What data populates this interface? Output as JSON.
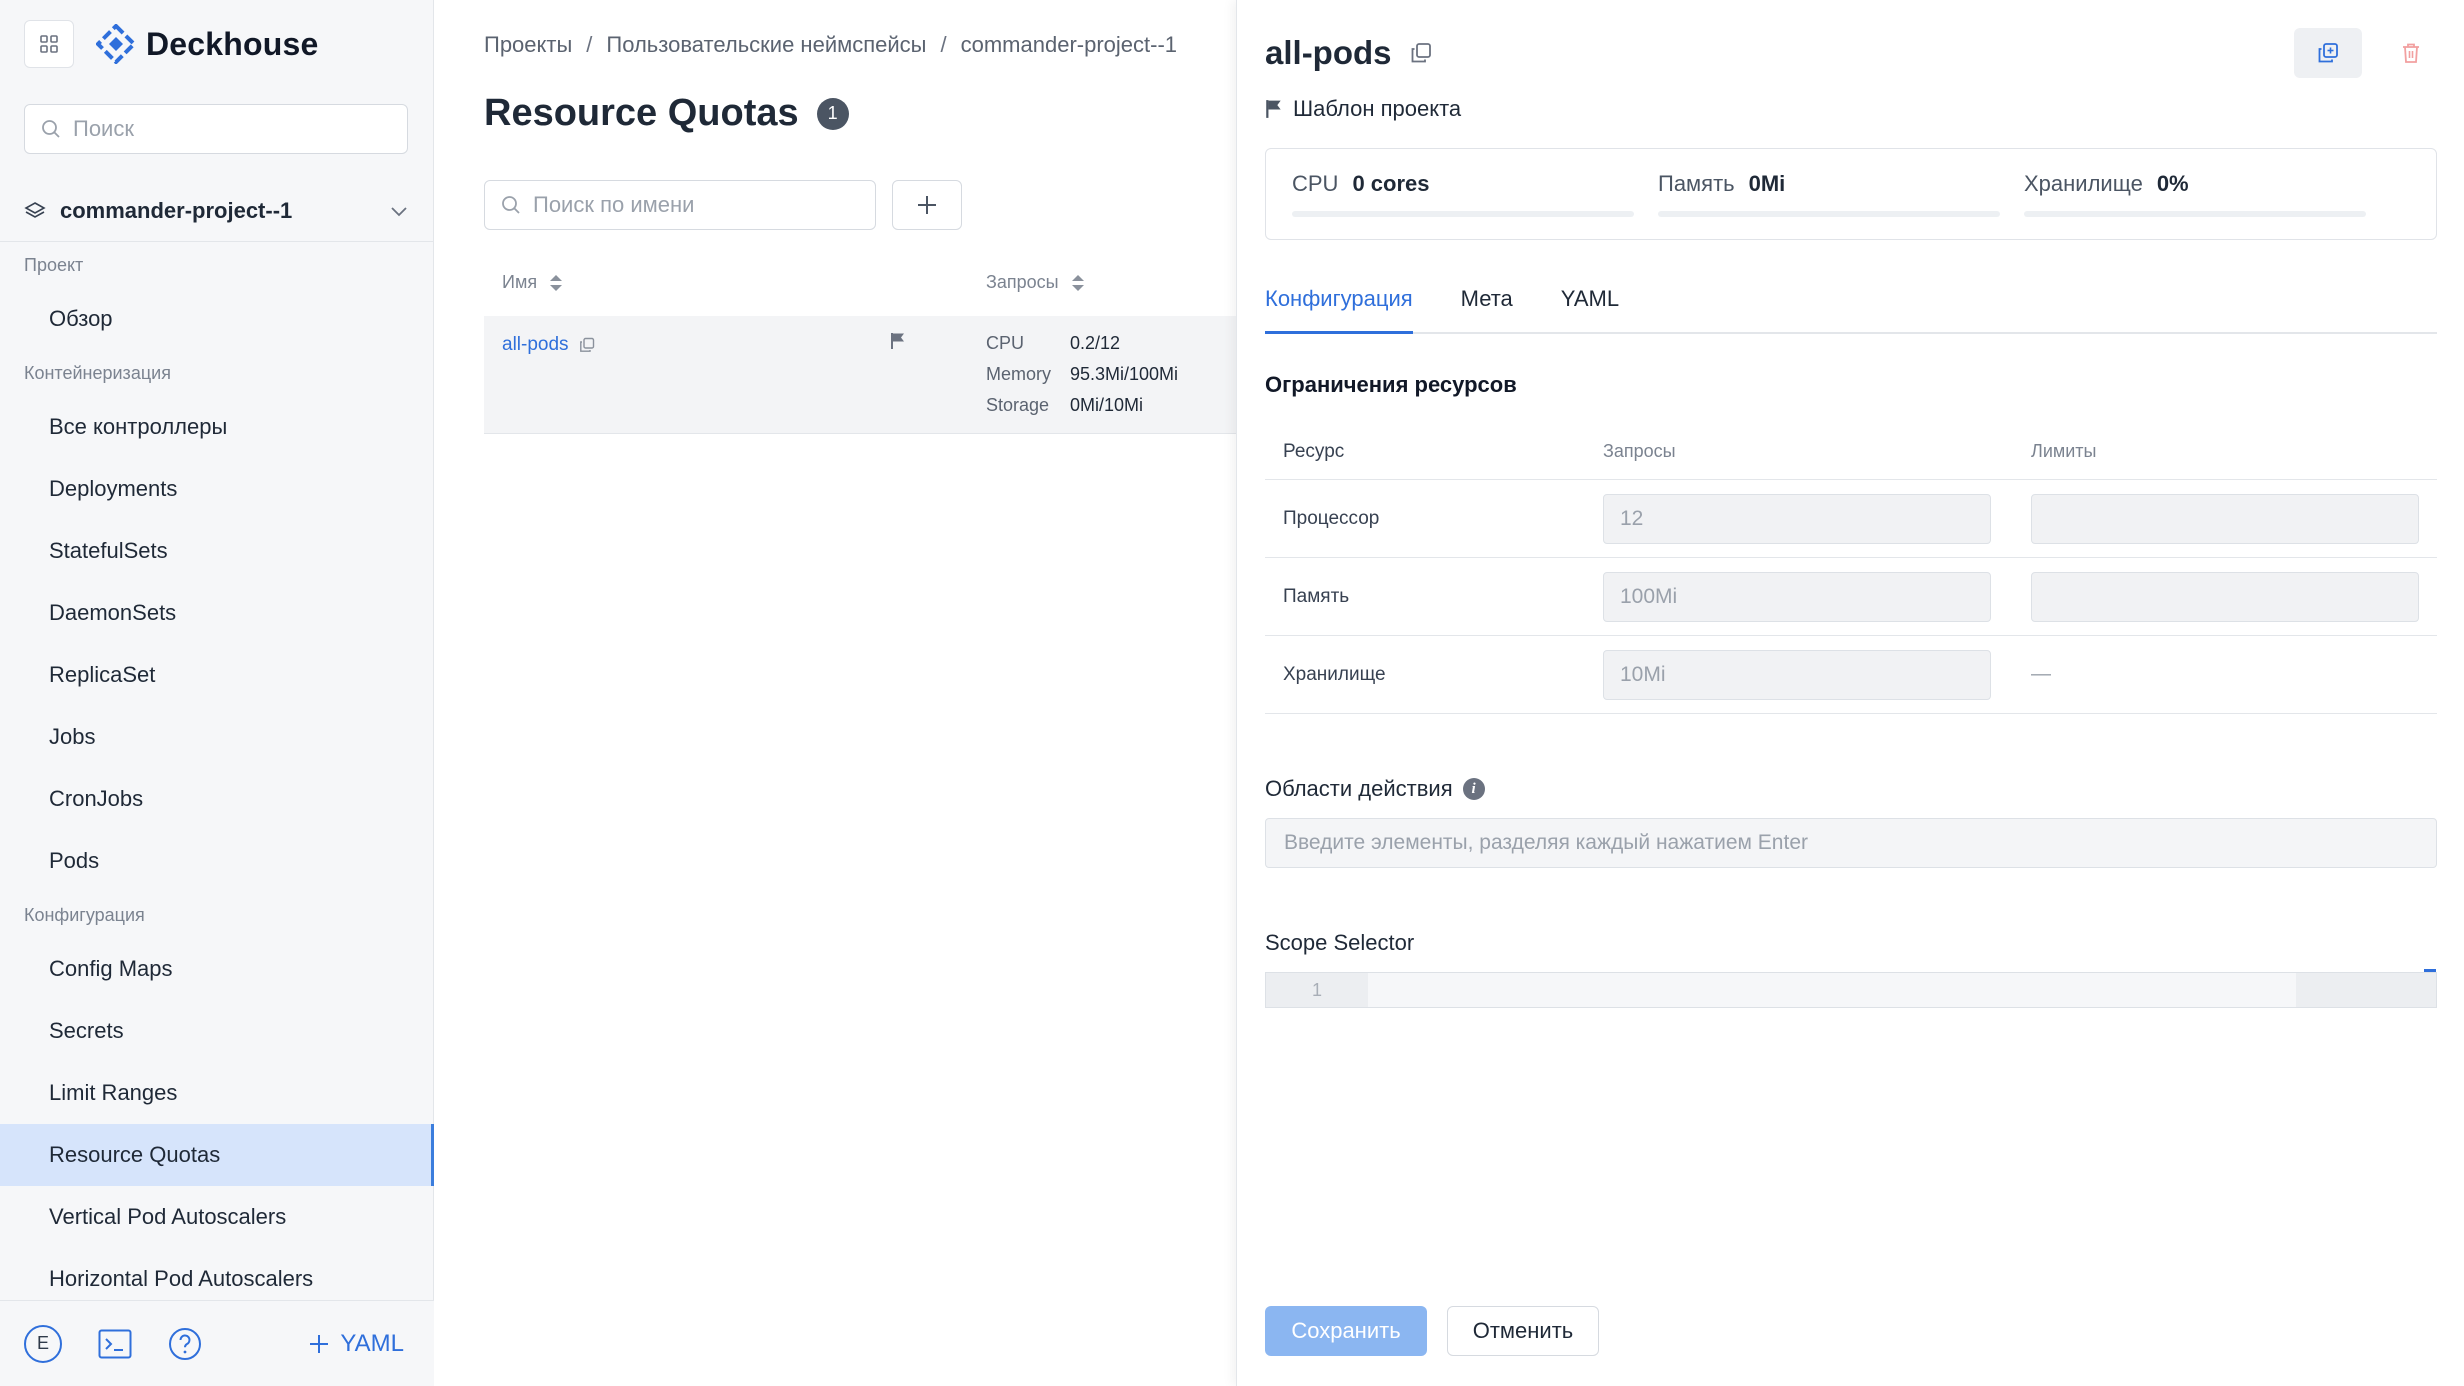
{
  "app": {
    "name": "Deckhouse",
    "brand_color": "#2f6fdb"
  },
  "sidebar": {
    "search_placeholder": "Поиск",
    "project": "commander-project--1",
    "groups": [
      {
        "label": "Проект",
        "items": [
          "Обзор"
        ]
      },
      {
        "label": "Контейнеризация",
        "items": [
          "Все контроллеры",
          "Deployments",
          "StatefulSets",
          "DaemonSets",
          "ReplicaSet",
          "Jobs",
          "CronJobs",
          "Pods"
        ]
      },
      {
        "label": "Конфигурация",
        "items": [
          "Config Maps",
          "Secrets",
          "Limit Ranges",
          "Resource Quotas",
          "Vertical Pod Autoscalers",
          "Horizontal Pod Autoscalers"
        ]
      }
    ],
    "active_item": "Resource Quotas",
    "user_initial": "E",
    "yaml_label": "YAML"
  },
  "main": {
    "breadcrumb": [
      "Проекты",
      "Пользовательские неймспейсы",
      "commander-project--1"
    ],
    "title": "Resource Quotas",
    "count": "1",
    "search_placeholder": "Поиск по имени",
    "columns": [
      "Имя",
      "Запросы"
    ],
    "rows": [
      {
        "name": "all-pods",
        "quotas": [
          {
            "key": "CPU",
            "value": "0.2/12"
          },
          {
            "key": "Memory",
            "value": "95.3Mi/100Mi"
          },
          {
            "key": "Storage",
            "value": "0Mi/10Mi"
          }
        ]
      }
    ]
  },
  "drawer": {
    "title": "all-pods",
    "template_label": "Шаблон проекта",
    "usage": [
      {
        "label": "CPU",
        "value": "0 cores"
      },
      {
        "label": "Память",
        "value": "0Mi"
      },
      {
        "label": "Хранилище",
        "value": "0%"
      }
    ],
    "tabs": [
      "Конфигурация",
      "Мета",
      "YAML"
    ],
    "active_tab": "Конфигурация",
    "section_title": "Ограничения ресурсов",
    "table_headers": [
      "Ресурс",
      "Запросы",
      "Лимиты"
    ],
    "resources": [
      {
        "name": "Процессор",
        "request": "12",
        "limit": ""
      },
      {
        "name": "Память",
        "request": "100Mi",
        "limit": ""
      },
      {
        "name": "Хранилище",
        "request": "10Mi",
        "limit": "—"
      }
    ],
    "scopes_label": "Области действия",
    "scopes_placeholder": "Введите элементы, разделяя каждый нажатием Enter",
    "scope_selector_label": "Scope Selector",
    "editor_line": "1",
    "save_label": "Сохранить",
    "cancel_label": "Отменить"
  }
}
